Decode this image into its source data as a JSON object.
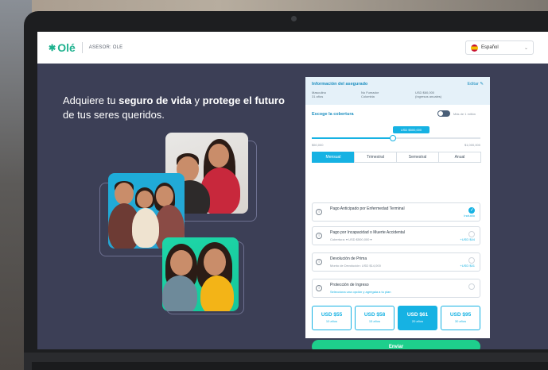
{
  "header": {
    "asesor_label": "ASESOR: OLE",
    "logo_text": "Olé",
    "language": "Español"
  },
  "hero": {
    "line_pre": "Adquiere tu",
    "bold1": "seguro de vida",
    "mid": "y",
    "bold2": "protege el futuro",
    "line_post": "de tus seres queridos."
  },
  "insured": {
    "title": "Información del asegurado",
    "edit_label": "Editar",
    "col1": [
      "Masculino",
      "31 años"
    ],
    "col2": [
      "No Fumador",
      "Colombia"
    ],
    "col3": [
      "USD $60,000",
      "(Ingresos anuales)"
    ]
  },
  "coverage": {
    "title": "Escoge la cobertura",
    "more_label": "Más de 1 millón",
    "selected_amount": "USD $500,000",
    "min_label": "$50,000",
    "max_label": "$1,000,000",
    "slider_fraction": 0.47
  },
  "tabs": [
    "Mensual",
    "Trimestral",
    "Semestral",
    "Anual"
  ],
  "options": [
    {
      "title": "Pago Anticipado por Enfermedad Terminal",
      "sub": "",
      "value": "Incluido",
      "checked": true
    },
    {
      "title": "Pago por Incapacidad o Muerte Accidental",
      "sub": "Cobertura: ▾ USD $500,000 ▾",
      "value": "+USD $44",
      "checked": false
    },
    {
      "title": "Devolución de Prima",
      "sub": "Monto de Devolución: USD $14,000",
      "value": "+USD $41",
      "checked": false
    },
    {
      "title": "Protección de Ingreso",
      "sub": "Selecciona una opción y agrégala a tu plan",
      "value": "",
      "checked": false
    }
  ],
  "prices": [
    {
      "amount": "USD $55",
      "years": "10 años"
    },
    {
      "amount": "USD $58",
      "years": "15 años"
    },
    {
      "amount": "USD $61",
      "years": "20 años"
    },
    {
      "amount": "USD $95",
      "years": "30 años"
    }
  ],
  "submit_label": "Enviar",
  "colors": {
    "accent": "#16b2e3",
    "brand": "#1fb28f",
    "submit": "#1ecf8c",
    "screen_bg": "#3c3f56"
  }
}
